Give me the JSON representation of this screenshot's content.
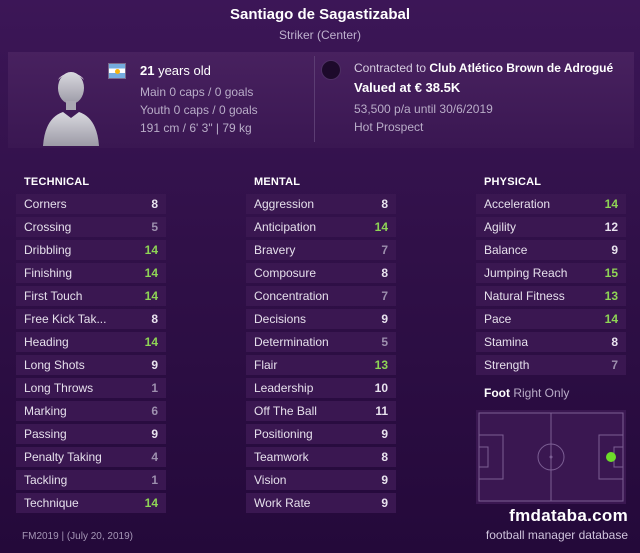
{
  "header": {
    "player_name": "Santiago de Sagastizabal",
    "position": "Striker (Center)"
  },
  "info": {
    "age_value": "21",
    "age_suffix": " years old",
    "main_caps": "Main 0 caps / 0 goals",
    "youth_caps": "Youth 0 caps / 0 goals",
    "physique": "191 cm / 6' 3\" | 79 kg",
    "contract_prefix": "Contracted to ",
    "contract_club": "Club Atlético Brown de Adrogué",
    "valued": "Valued at € 38.5K",
    "wage": "53,500 p/a until 30/6/2019",
    "status": "Hot Prospect",
    "flag_icon": "argentina-flag-icon"
  },
  "colors": {
    "high_value": "#8ed455",
    "mid_value": "#e8e2ee",
    "low_value": "#9d8fae",
    "background": "#2a0b3c",
    "row_bg": "#3a1751"
  },
  "technical": {
    "title": "TECHNICAL",
    "items": [
      {
        "label": "Corners",
        "value": "8"
      },
      {
        "label": "Crossing",
        "value": "5"
      },
      {
        "label": "Dribbling",
        "value": "14"
      },
      {
        "label": "Finishing",
        "value": "14"
      },
      {
        "label": "First Touch",
        "value": "14"
      },
      {
        "label": "Free Kick Tak...",
        "value": "8"
      },
      {
        "label": "Heading",
        "value": "14"
      },
      {
        "label": "Long Shots",
        "value": "9"
      },
      {
        "label": "Long Throws",
        "value": "1"
      },
      {
        "label": "Marking",
        "value": "6"
      },
      {
        "label": "Passing",
        "value": "9"
      },
      {
        "label": "Penalty Taking",
        "value": "4"
      },
      {
        "label": "Tackling",
        "value": "1"
      },
      {
        "label": "Technique",
        "value": "14"
      }
    ]
  },
  "mental": {
    "title": "MENTAL",
    "items": [
      {
        "label": "Aggression",
        "value": "8"
      },
      {
        "label": "Anticipation",
        "value": "14"
      },
      {
        "label": "Bravery",
        "value": "7"
      },
      {
        "label": "Composure",
        "value": "8"
      },
      {
        "label": "Concentration",
        "value": "7"
      },
      {
        "label": "Decisions",
        "value": "9"
      },
      {
        "label": "Determination",
        "value": "5"
      },
      {
        "label": "Flair",
        "value": "13"
      },
      {
        "label": "Leadership",
        "value": "10"
      },
      {
        "label": "Off The Ball",
        "value": "11"
      },
      {
        "label": "Positioning",
        "value": "9"
      },
      {
        "label": "Teamwork",
        "value": "8"
      },
      {
        "label": "Vision",
        "value": "9"
      },
      {
        "label": "Work Rate",
        "value": "9"
      }
    ]
  },
  "physical": {
    "title": "PHYSICAL",
    "items": [
      {
        "label": "Acceleration",
        "value": "14"
      },
      {
        "label": "Agility",
        "value": "12"
      },
      {
        "label": "Balance",
        "value": "9"
      },
      {
        "label": "Jumping Reach",
        "value": "15"
      },
      {
        "label": "Natural Fitness",
        "value": "13"
      },
      {
        "label": "Pace",
        "value": "14"
      },
      {
        "label": "Stamina",
        "value": "8"
      },
      {
        "label": "Strength",
        "value": "7"
      }
    ]
  },
  "foot": {
    "label": "Foot",
    "value": " Right Only"
  },
  "footer": {
    "version": "FM2019 | (July 20, 2019)",
    "brand": "fmdataba.com",
    "brand_sub": "football manager database"
  }
}
